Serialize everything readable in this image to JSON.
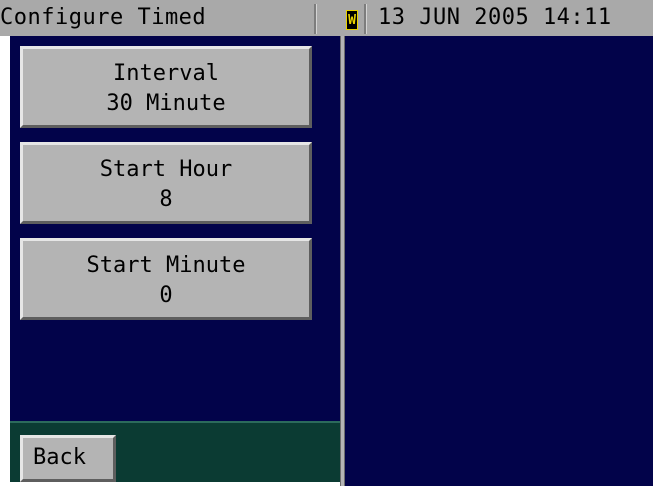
{
  "titlebar": {
    "title": "Configure Timed",
    "warning_badge": "W",
    "datetime": "13 JUN 2005 14:11"
  },
  "menu": {
    "interval": {
      "label": "Interval",
      "value": "30 Minute"
    },
    "start_hour": {
      "label": "Start Hour",
      "value": "8"
    },
    "start_minute": {
      "label": "Start Minute",
      "value": "0"
    }
  },
  "footer": {
    "back_label": "Back"
  },
  "colors": {
    "panel_bg": "#02034a",
    "footer_bg": "#0b3b33",
    "button_face": "#b4b4b4",
    "titlebar_bg": "#a9a9a9",
    "warning": "#e8d200"
  }
}
